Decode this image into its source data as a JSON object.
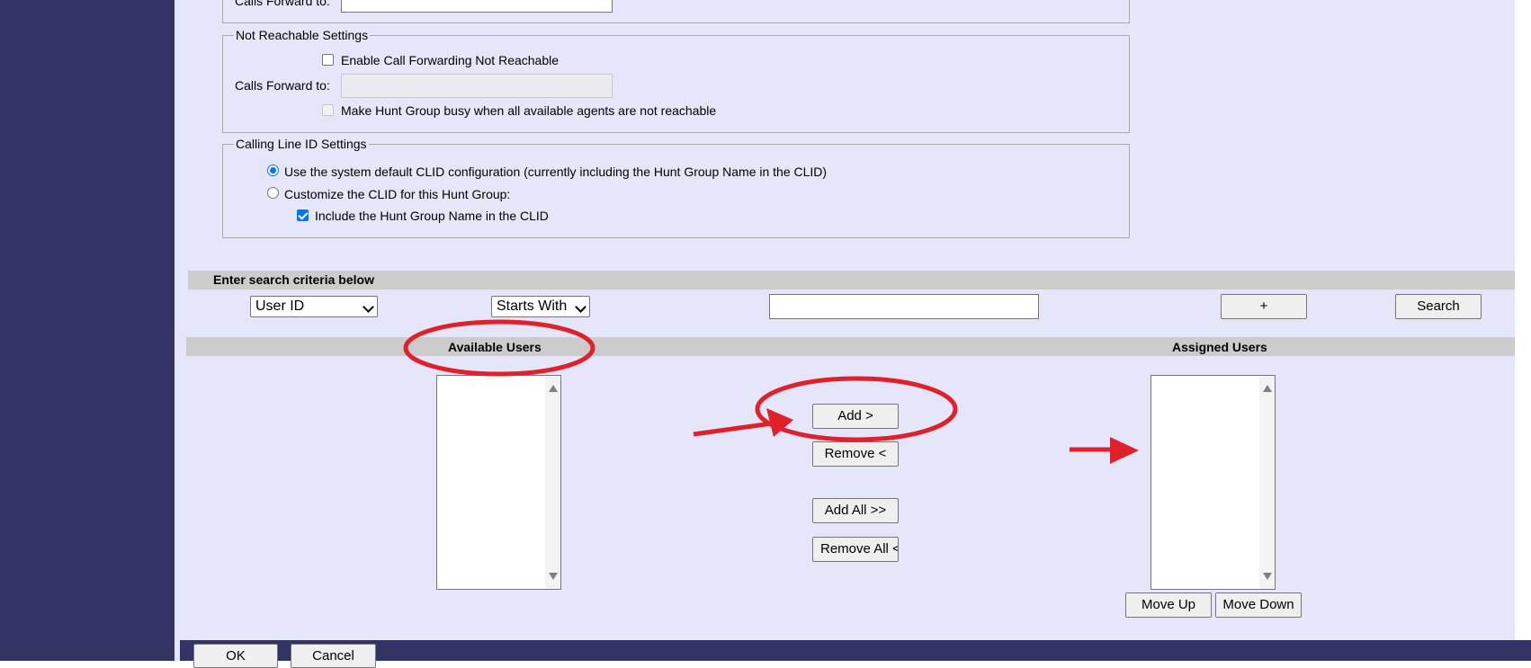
{
  "forwarding": {
    "busy_calls_forward_label": "Calls Forward to:"
  },
  "not_reachable": {
    "legend": "Not Reachable Settings",
    "enable_label": "Enable Call Forwarding Not Reachable",
    "enable_checked": false,
    "calls_forward_label": "Calls Forward to:",
    "calls_forward_value": "",
    "busy_label": "Make Hunt Group busy when all available agents are not reachable",
    "busy_checked": false
  },
  "clid": {
    "legend": "Calling Line ID Settings",
    "option_default": "Use the system default CLID configuration (currently including the Hunt Group Name in the CLID)",
    "option_custom": "Customize the CLID for this Hunt Group:",
    "selected": "default",
    "include_name_label": "Include the Hunt Group Name in the CLID",
    "include_name_checked": true
  },
  "search": {
    "header": "Enter search criteria below",
    "field_select": "User ID",
    "mode_select": "Starts With",
    "value": "",
    "plus_label": "+",
    "search_label": "Search"
  },
  "lists": {
    "available_header": "Available Users",
    "assigned_header": "Assigned Users",
    "available_items": [],
    "assigned_items": []
  },
  "transfer_buttons": {
    "add": "Add >",
    "remove": "Remove <",
    "add_all": "Add All >>",
    "remove_all": "Remove All <<"
  },
  "order_buttons": {
    "move_up": "Move Up",
    "move_down": "Move Down"
  },
  "footer": {
    "ok": "OK",
    "cancel": "Cancel"
  },
  "colors": {
    "sidebar": "#333366",
    "content_bg": "#e6e6fa",
    "header_bar": "#cccccc",
    "annotation": "#e0202a",
    "accent": "#0075ff"
  },
  "icons": {
    "scroll_up": "scroll-up-arrow-icon",
    "scroll_down": "scroll-down-arrow-icon",
    "dropdown": "chevron-down-icon"
  }
}
